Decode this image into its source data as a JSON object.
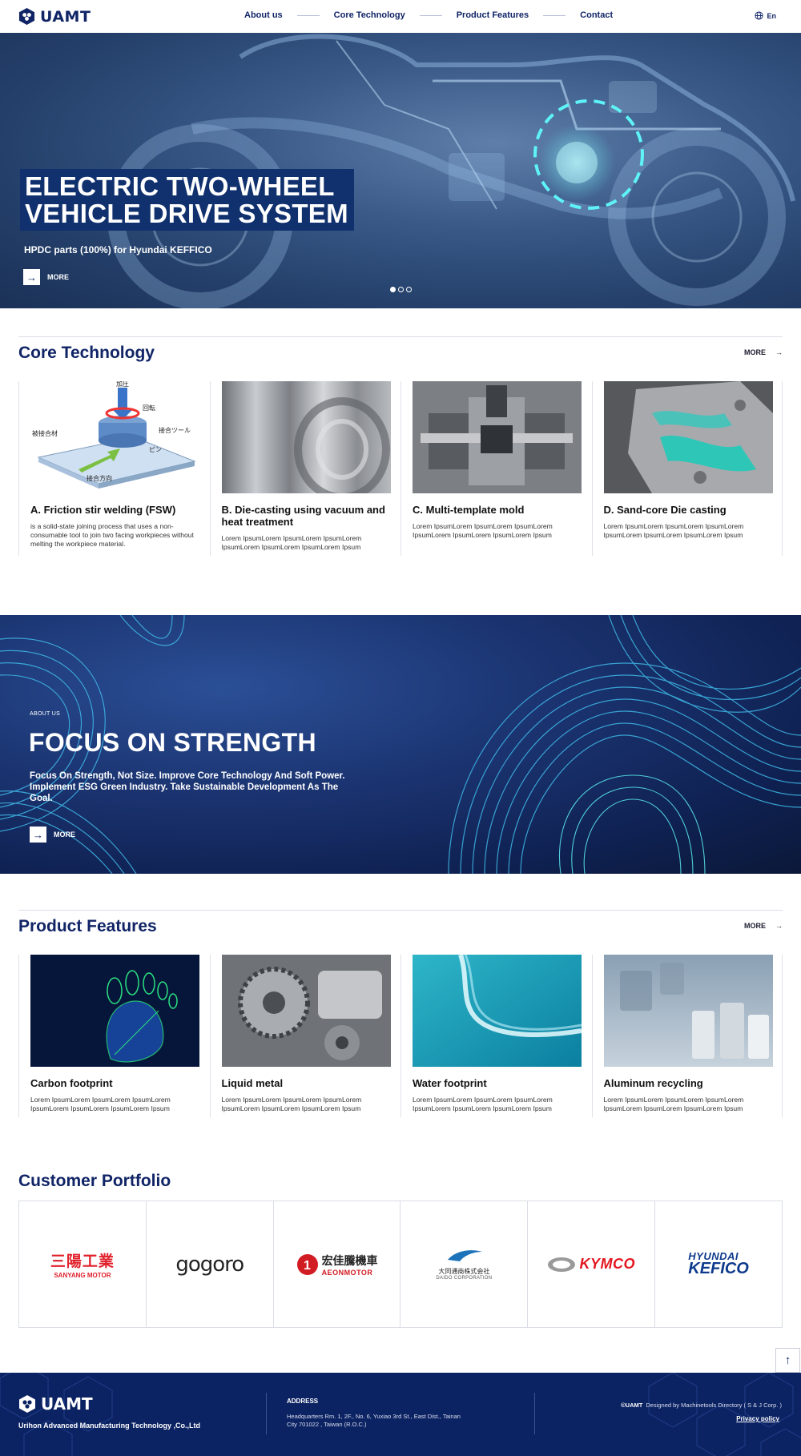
{
  "header": {
    "logo_text": "UAMT",
    "nav": [
      "About us",
      "Core Technology",
      "Product Features",
      "Contact"
    ],
    "lang": "En"
  },
  "hero": {
    "title": "ELECTRIC TWO-WHEEL\nVEHICLE DRIVE SYSTEM",
    "subtitle": "HPDC parts (100%) for Hyundai KEFFICO",
    "more": "MORE",
    "slides": 3,
    "active_slide": 1
  },
  "core": {
    "title": "Core Technology",
    "more": "MORE",
    "cards": [
      {
        "title": "A. Friction stir welding (FSW)",
        "desc": "is a solid-state joining process that uses a non-consumable tool to join two facing workpieces without melting the workpiece material.",
        "diagram_labels": [
          "加圧",
          "回転",
          "接合ツール",
          "ピン",
          "被接合材",
          "接合方向"
        ]
      },
      {
        "title": "B. Die-casting using vacuum and heat treatment",
        "desc": "Lorem IpsumLorem IpsumLorem IpsumLorem IpsumLorem IpsumLorem IpsumLorem Ipsum"
      },
      {
        "title": "C. Multi-template mold",
        "desc": "Lorem IpsumLorem IpsumLorem IpsumLorem IpsumLorem IpsumLorem IpsumLorem Ipsum"
      },
      {
        "title": "D. Sand-core Die casting",
        "desc": "Lorem IpsumLorem IpsumLorem IpsumLorem IpsumLorem IpsumLorem IpsumLorem Ipsum"
      }
    ]
  },
  "about": {
    "kicker": "ABOUT US",
    "title": "FOCUS ON STRENGTH",
    "text": "Focus On Strength, Not Size. Improve Core Technology And Soft Power. Implement ESG Green Industry. Take Sustainable Development As The Goal.",
    "more": "MORE"
  },
  "features": {
    "title": "Product Features",
    "more": "MORE",
    "cards": [
      {
        "title": "Carbon footprint",
        "desc": "Lorem IpsumLorem IpsumLorem IpsumLorem IpsumLorem IpsumLorem IpsumLorem Ipsum"
      },
      {
        "title": "Liquid metal",
        "desc": "Lorem IpsumLorem IpsumLorem IpsumLorem IpsumLorem IpsumLorem IpsumLorem Ipsum"
      },
      {
        "title": "Water footprint",
        "desc": "Lorem IpsumLorem IpsumLorem IpsumLorem IpsumLorem IpsumLorem IpsumLorem Ipsum"
      },
      {
        "title": "Aluminum recycling",
        "desc": "Lorem IpsumLorem IpsumLorem IpsumLorem IpsumLorem IpsumLorem IpsumLorem Ipsum"
      }
    ]
  },
  "customers": {
    "title": "Customer Portfolio",
    "logos": [
      {
        "name": "sanyang",
        "line1": "三陽工業",
        "line2": "SANYANG MOTOR",
        "color": "#e0202b"
      },
      {
        "name": "gogoro",
        "line1": "gogoro",
        "color": "#222222"
      },
      {
        "name": "aeon",
        "line1": "宏佳騰機車",
        "line2": "AEONMOTOR",
        "color": "#d21c23"
      },
      {
        "name": "daido",
        "line1": "大同通商株式会社",
        "line2": "DAIDO CORPORATION",
        "color": "#1d73b9"
      },
      {
        "name": "kymco",
        "line1": "KYMCO",
        "color": "#e3161f"
      },
      {
        "name": "hyundai-kefico",
        "line1": "HYUNDAI",
        "line2": "KEFICO",
        "color": "#0d3a8c"
      }
    ]
  },
  "footer": {
    "logo_text": "UAMT",
    "company": "Urihon Advanced Manufacturing Technology ,Co.,Ltd",
    "address_label": "ADDRESS",
    "address": "Headquarters Rm. 1, 2F., No. 6, Yuxiao 3rd St., East Dist., Tainan City 701022 , Taiwan (R.O.C.)",
    "copyright_brand": "©UAMT",
    "credit": "Designed by Machinetools Directory ( S & J Corp. )",
    "privacy": "Privacy policy"
  },
  "colors": {
    "brand": "#102466",
    "footer_bg": "#0c2363",
    "accent_cyan": "#4fe0e8"
  }
}
